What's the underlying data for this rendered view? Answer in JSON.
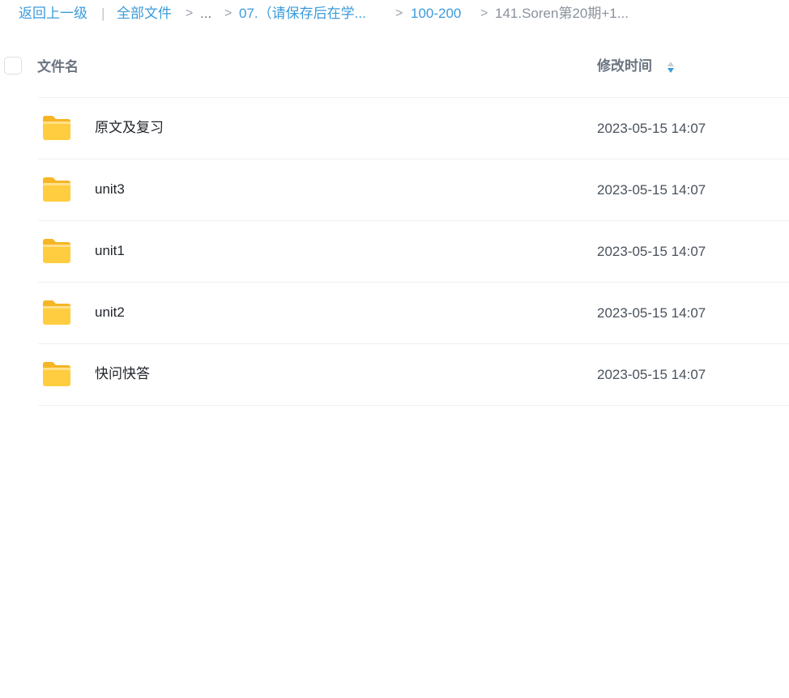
{
  "breadcrumb": {
    "back": "返回上一级",
    "divider": "|",
    "all_files": "全部文件",
    "sep": ">",
    "ellipsis": "...",
    "level_07": "07.（请保存后在学...",
    "level_100_200": "100-200",
    "current": "141.Soren第20期+1..."
  },
  "table": {
    "col_name": "文件名",
    "col_time": "修改时间"
  },
  "files": [
    {
      "name": "原文及复习",
      "time": "2023-05-15 14:07",
      "icon": "folder-icon"
    },
    {
      "name": "unit3",
      "time": "2023-05-15 14:07",
      "icon": "folder-icon"
    },
    {
      "name": "unit1",
      "time": "2023-05-15 14:07",
      "icon": "folder-icon"
    },
    {
      "name": "unit2",
      "time": "2023-05-15 14:07",
      "icon": "folder-icon"
    },
    {
      "name": "快问快答",
      "time": "2023-05-15 14:07",
      "icon": "folder-icon"
    }
  ],
  "colors": {
    "link": "#3b9bdb",
    "folder": "#ffc53d",
    "sort_active": "#3b9bdb"
  }
}
